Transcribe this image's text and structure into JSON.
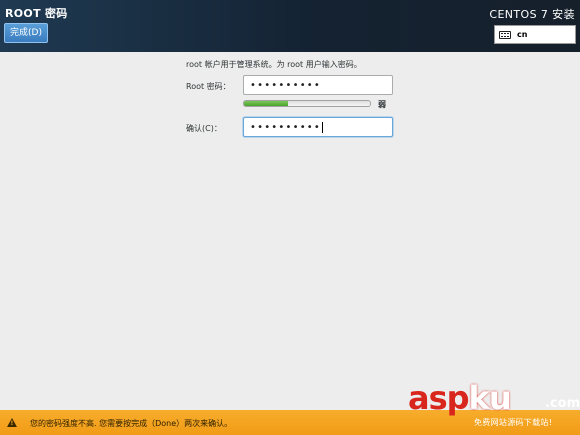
{
  "header": {
    "title": "ROOT 密码",
    "done_label": "完成(D)",
    "install_title": "CENTOS 7 安装",
    "keyboard": {
      "icon": "keyboard-icon",
      "layout": "cn"
    }
  },
  "form": {
    "instruction": "root 帐户用于管理系统。为 root 用户输入密码。",
    "root_password_label": "Root 密码：",
    "root_password_value": "••••••••••",
    "strength_fraction": 0.35,
    "strength_label": "弱",
    "confirm_label": "确认(C)：",
    "confirm_value": "••••••••••"
  },
  "warning": {
    "icon": "warning-icon",
    "text": "您的密码强度不高. 您需要按完成（Done）两次来确认。"
  },
  "watermark": {
    "main": "asp",
    "main_accent": "ku",
    "suffix": ".com",
    "subtitle": "免费网站源码下载站!"
  },
  "colors": {
    "header_bg": "#1b2a3b",
    "accent_blue": "#3a7cc0",
    "strength_green": "#4ca22e",
    "warning_bg": "#f5a623",
    "watermark_red": "#d9261c"
  }
}
